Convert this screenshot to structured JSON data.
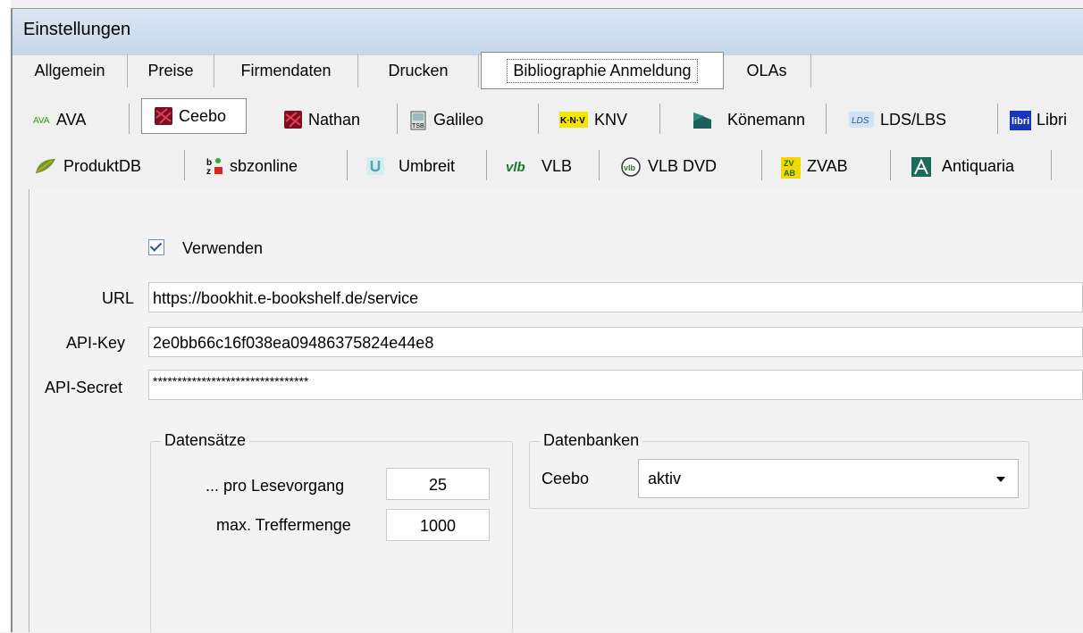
{
  "window": {
    "title": "Einstellungen"
  },
  "main_tabs": [
    {
      "label": "Allgemein"
    },
    {
      "label": "Preise"
    },
    {
      "label": "Firmendaten"
    },
    {
      "label": "Drucken"
    },
    {
      "label": "Bibliographie Anmeldung",
      "active": true
    },
    {
      "label": "OLAs"
    }
  ],
  "provider_tabs_row1": [
    {
      "label": "AVA",
      "icon": "ava-icon"
    },
    {
      "label": "Ceebo",
      "icon": "ceebo-icon",
      "active": true
    },
    {
      "label": "Nathan",
      "icon": "nathan-icon"
    },
    {
      "label": "Galileo",
      "icon": "galileo-icon"
    },
    {
      "label": "KNV",
      "icon": "knv-icon"
    },
    {
      "label": "Könemann",
      "icon": "koenemann-icon"
    },
    {
      "label": "LDS/LBS",
      "icon": "lds-icon"
    },
    {
      "label": "Libri",
      "icon": "libri-icon"
    }
  ],
  "provider_tabs_row2": [
    {
      "label": "ProduktDB",
      "icon": "produktdb-icon"
    },
    {
      "label": "sbzonline",
      "icon": "sbzonline-icon"
    },
    {
      "label": "Umbreit",
      "icon": "umbreit-icon"
    },
    {
      "label": "VLB",
      "icon": "vlb-icon"
    },
    {
      "label": "VLB DVD",
      "icon": "vlb-dvd-icon"
    },
    {
      "label": "ZVAB",
      "icon": "zvab-icon"
    },
    {
      "label": "Antiquaria",
      "icon": "antiquaria-icon"
    }
  ],
  "settings": {
    "use_label": "Verwenden",
    "use_checked": true,
    "url_label": "URL",
    "url_value": "https://bookhit.e-bookshelf.de/service",
    "api_key_label": "API-Key",
    "api_key_value": "2e0bb66c16f038ea09486375824e44e8",
    "api_secret_label": "API-Secret",
    "api_secret_value": "********************************"
  },
  "datensaetze": {
    "title": "Datensätze",
    "per_read_label": "... pro Lesevorgang",
    "per_read_value": "25",
    "max_hits_label": "max. Treffermenge",
    "max_hits_value": "1000"
  },
  "datenbanken": {
    "title": "Datenbanken",
    "db_label": "Ceebo",
    "db_value": "aktiv"
  }
}
